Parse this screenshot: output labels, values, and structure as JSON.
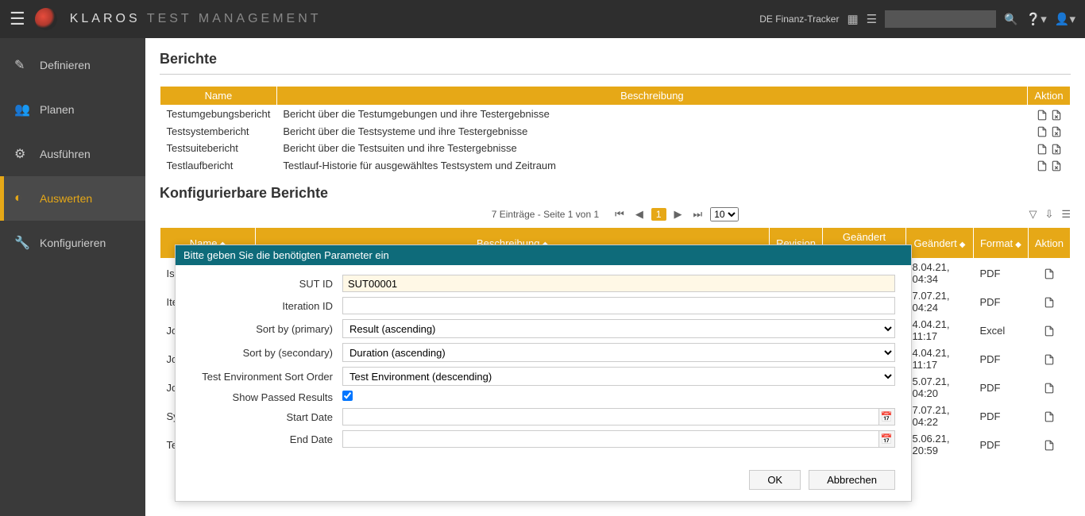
{
  "top": {
    "project": "DE Finanz-Tracker",
    "brand1": "KLAROS",
    "brand2": "TEST MANAGEMENT"
  },
  "sidebar": {
    "items": [
      {
        "label": "Definieren"
      },
      {
        "label": "Planen"
      },
      {
        "label": "Ausführen"
      },
      {
        "label": "Auswerten"
      },
      {
        "label": "Konfigurieren"
      }
    ]
  },
  "section1": {
    "title": "Berichte",
    "cols": {
      "name": "Name",
      "desc": "Beschreibung",
      "aktion": "Aktion"
    },
    "rows": [
      {
        "name": "Testumgebungsbericht",
        "desc": "Bericht über die Testumgebungen und ihre Testergebnisse"
      },
      {
        "name": "Testsystembericht",
        "desc": "Bericht über die Testsysteme und ihre Testergebnisse"
      },
      {
        "name": "Testsuitebericht",
        "desc": "Bericht über die Testsuiten und ihre Testergebnisse"
      },
      {
        "name": "Testlaufbericht",
        "desc": "Testlauf-Historie für ausgewähltes Testsystem und Zeitraum"
      }
    ]
  },
  "section2": {
    "title": "Konfigurierbare Berichte",
    "pager": "7 Einträge - Seite 1 von 1",
    "page": "1",
    "pagesize": "10",
    "cols": {
      "name": "Name",
      "desc": "Beschreibung",
      "rev": "Revision",
      "changedby": "Geändert von",
      "changed": "Geändert",
      "format": "Format",
      "aktion": "Aktion"
    },
    "rows": [
      {
        "name": "Iss",
        "changed": "8.04.21, 04:34",
        "format": "PDF"
      },
      {
        "name": "Ite",
        "changed": "7.07.21, 04:24",
        "format": "PDF"
      },
      {
        "name": "Jol",
        "changed": "4.04.21, 11:17",
        "format": "Excel"
      },
      {
        "name": "Jol",
        "changed": "4.04.21, 11:17",
        "format": "PDF"
      },
      {
        "name": "Jol",
        "changed": "5.07.21, 04:20",
        "format": "PDF"
      },
      {
        "name": "Sy",
        "changed": "7.07.21, 04:22",
        "format": "PDF"
      },
      {
        "name": "Te",
        "changed": "5.06.21, 20:59",
        "format": "PDF"
      }
    ]
  },
  "modal": {
    "title": "Bitte geben Sie die benötigten Parameter ein",
    "labels": {
      "sut": "SUT ID",
      "iter": "Iteration ID",
      "sort1": "Sort by (primary)",
      "sort2": "Sort by (secondary)",
      "envsort": "Test Environment Sort Order",
      "passed": "Show Passed Results",
      "start": "Start Date",
      "end": "End Date"
    },
    "values": {
      "sut": "SUT00001",
      "iter": "",
      "sort1": "Result (ascending)",
      "sort2": "Duration (ascending)",
      "envsort": "Test Environment (descending)",
      "passed": true
    },
    "buttons": {
      "ok": "OK",
      "cancel": "Abbrechen"
    }
  }
}
